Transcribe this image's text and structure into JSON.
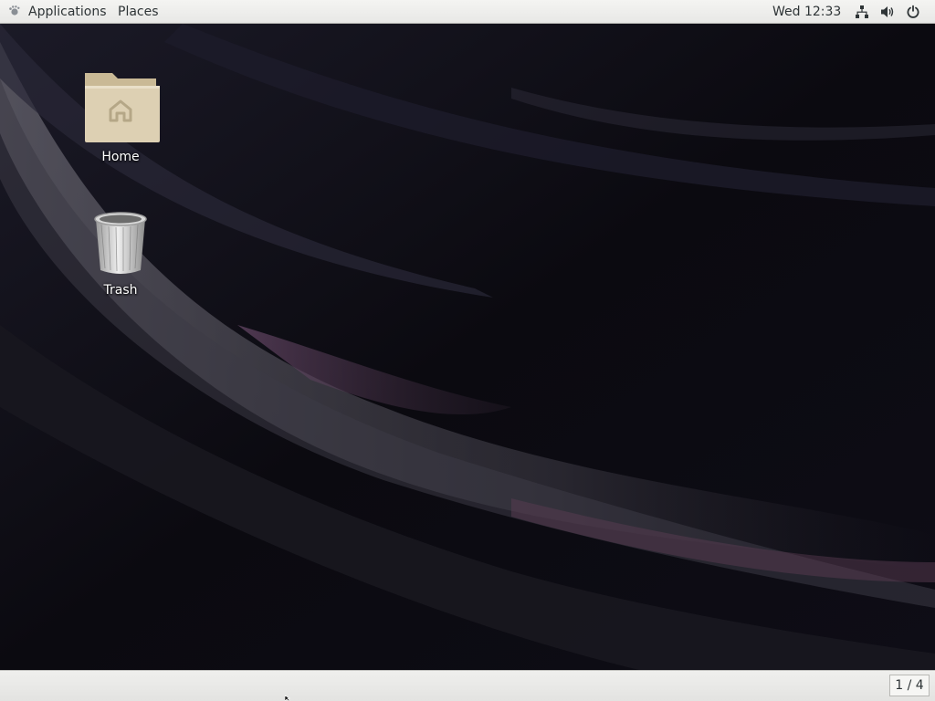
{
  "top_bar": {
    "applications_label": "Applications",
    "places_label": "Places",
    "clock": "Wed 12:33",
    "icons": [
      "gnome-foot-icon",
      "network-icon",
      "volume-icon",
      "power-icon"
    ]
  },
  "desktop": {
    "icons": [
      {
        "label": "Home",
        "icon": "home-folder-icon"
      },
      {
        "label": "Trash",
        "icon": "trash-icon"
      }
    ]
  },
  "bottom_bar": {
    "workspace_indicator": "1 / 4"
  },
  "colors": {
    "panel": "#ebebe9",
    "desktop_bg": "#0d0c12",
    "panel_text": "#2e3436"
  }
}
